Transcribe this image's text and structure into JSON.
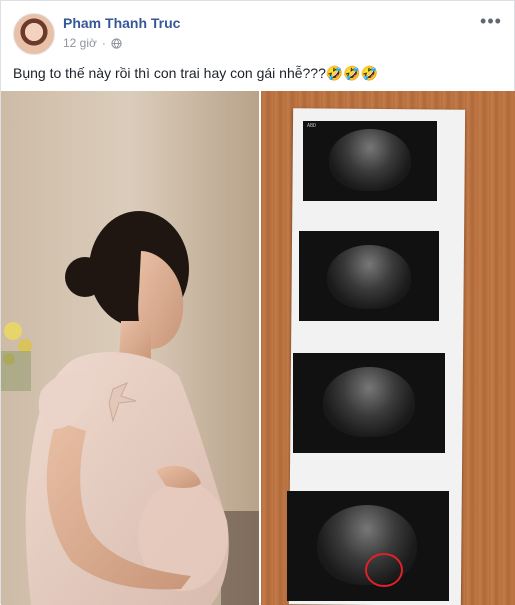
{
  "post": {
    "author_name": "Pham Thanh Truc",
    "timestamp": "12 giờ",
    "privacy_icon": "globe-icon",
    "more_icon": "more-options-icon",
    "text": "Bụng to thế này rồi thì con trai hay con gái nhễ???🤣🤣🤣"
  },
  "photos": [
    {
      "name": "photo-pregnant-woman"
    },
    {
      "name": "photo-ultrasound-prints"
    }
  ],
  "colors": {
    "author": "#365899",
    "meta": "#90949c",
    "text": "#1d2129",
    "circle_mark": "#e0202a"
  }
}
